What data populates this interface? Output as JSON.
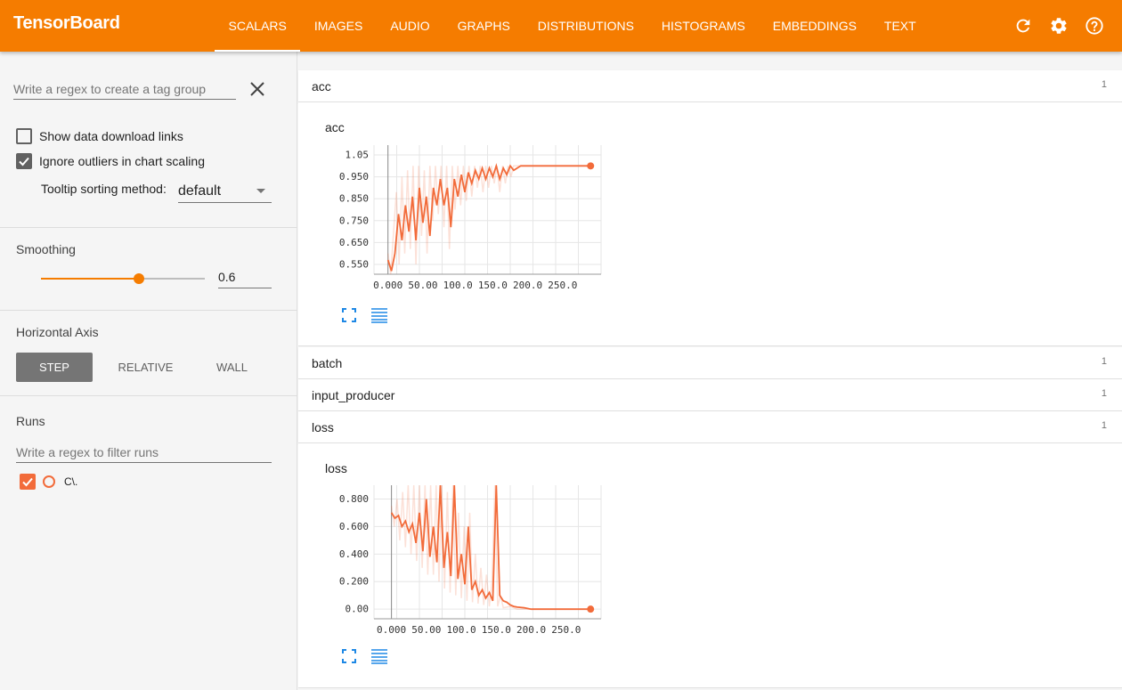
{
  "topbar": {
    "brand": "TensorBoard",
    "tabs": [
      "SCALARS",
      "IMAGES",
      "AUDIO",
      "GRAPHS",
      "DISTRIBUTIONS",
      "HISTOGRAMS",
      "EMBEDDINGS",
      "TEXT"
    ],
    "active_tab": "SCALARS",
    "icons": [
      "refresh-icon",
      "settings-icon",
      "help-icon"
    ]
  },
  "sidebar": {
    "tag_regex_placeholder": "Write a regex to create a tag group",
    "show_download_label": "Show data download links",
    "show_download_checked": false,
    "ignore_outliers_label": "Ignore outliers in chart scaling",
    "ignore_outliers_checked": true,
    "tooltip_sort_label": "Tooltip sorting method:",
    "tooltip_sort_value": "default",
    "smoothing_title": "Smoothing",
    "smoothing_value": "0.6",
    "horizontal_axis_title": "Horizontal Axis",
    "axis_options": [
      "STEP",
      "RELATIVE",
      "WALL"
    ],
    "axis_active": "STEP",
    "runs_title": "Runs",
    "runs_filter_placeholder": "Write a regex to filter runs",
    "runs": [
      {
        "name": "C\\.",
        "checked": true,
        "color": "#f26b3a"
      }
    ]
  },
  "groups": [
    {
      "name": "acc",
      "count": "1"
    },
    {
      "name": "batch",
      "count": "1"
    },
    {
      "name": "input_producer",
      "count": "1"
    },
    {
      "name": "loss",
      "count": "1"
    }
  ],
  "accent_color": "#f57c00",
  "series_color": "#f26b3a",
  "chart_data": [
    {
      "type": "line",
      "title": "acc",
      "x_ticks": [
        "0.000",
        "50.00",
        "100.0",
        "150.0",
        "200.0",
        "250.0"
      ],
      "y_ticks": [
        "0.550",
        "0.650",
        "0.750",
        "0.850",
        "0.950",
        "1.05"
      ],
      "xlim": [
        -20,
        305
      ],
      "ylim": [
        0.505,
        1.095
      ],
      "series": [
        {
          "smoothed": [
            [
              0,
              0.57
            ],
            [
              5,
              0.52
            ],
            [
              10,
              0.6
            ],
            [
              15,
              0.78
            ],
            [
              20,
              0.66
            ],
            [
              25,
              0.82
            ],
            [
              30,
              0.7
            ],
            [
              35,
              0.86
            ],
            [
              40,
              0.66
            ],
            [
              45,
              0.9
            ],
            [
              50,
              0.74
            ],
            [
              55,
              0.86
            ],
            [
              60,
              0.68
            ],
            [
              65,
              0.9
            ],
            [
              70,
              0.82
            ],
            [
              75,
              0.94
            ],
            [
              80,
              0.82
            ],
            [
              85,
              0.9
            ],
            [
              90,
              0.72
            ],
            [
              95,
              0.94
            ],
            [
              100,
              0.86
            ],
            [
              105,
              0.96
            ],
            [
              110,
              0.88
            ],
            [
              115,
              0.97
            ],
            [
              120,
              0.92
            ],
            [
              125,
              0.98
            ],
            [
              130,
              0.94
            ],
            [
              135,
              0.99
            ],
            [
              140,
              0.94
            ],
            [
              145,
              0.99
            ],
            [
              150,
              0.95
            ],
            [
              155,
              1.0
            ],
            [
              160,
              0.94
            ],
            [
              165,
              0.99
            ],
            [
              170,
              0.96
            ],
            [
              175,
              1.0
            ],
            [
              180,
              0.98
            ],
            [
              190,
              1.0
            ],
            [
              200,
              1.0
            ],
            [
              210,
              1.0
            ],
            [
              220,
              1.0
            ],
            [
              230,
              1.0
            ],
            [
              240,
              1.0
            ],
            [
              250,
              1.0
            ],
            [
              260,
              1.0
            ],
            [
              270,
              1.0
            ],
            [
              280,
              1.0
            ],
            [
              290,
              1.0
            ]
          ],
          "raw": [
            [
              0,
              0.6
            ],
            [
              4,
              0.5
            ],
            [
              8,
              0.7
            ],
            [
              12,
              0.88
            ],
            [
              16,
              0.55
            ],
            [
              20,
              0.95
            ],
            [
              24,
              0.6
            ],
            [
              28,
              0.98
            ],
            [
              32,
              0.62
            ],
            [
              36,
              1.0
            ],
            [
              40,
              0.55
            ],
            [
              44,
              1.0
            ],
            [
              48,
              0.68
            ],
            [
              52,
              0.98
            ],
            [
              56,
              0.6
            ],
            [
              60,
              1.0
            ],
            [
              64,
              0.75
            ],
            [
              68,
              1.0
            ],
            [
              72,
              0.78
            ],
            [
              76,
              1.0
            ],
            [
              80,
              0.72
            ],
            [
              84,
              1.0
            ],
            [
              88,
              0.62
            ],
            [
              92,
              1.0
            ],
            [
              96,
              0.8
            ],
            [
              100,
              1.0
            ],
            [
              104,
              0.82
            ],
            [
              108,
              1.0
            ],
            [
              112,
              0.84
            ],
            [
              116,
              1.0
            ],
            [
              120,
              0.86
            ],
            [
              124,
              1.0
            ],
            [
              128,
              0.9
            ],
            [
              132,
              1.0
            ],
            [
              136,
              0.88
            ],
            [
              140,
              1.0
            ],
            [
              144,
              0.9
            ],
            [
              148,
              1.0
            ],
            [
              152,
              0.92
            ],
            [
              156,
              1.0
            ],
            [
              160,
              0.88
            ],
            [
              164,
              1.0
            ],
            [
              168,
              0.92
            ],
            [
              172,
              1.0
            ],
            [
              176,
              0.95
            ],
            [
              180,
              1.0
            ],
            [
              190,
              1.0
            ],
            [
              200,
              1.0
            ],
            [
              290,
              1.0
            ]
          ]
        }
      ]
    },
    {
      "type": "line",
      "title": "loss",
      "x_ticks": [
        "0.000",
        "50.00",
        "100.0",
        "150.0",
        "200.0",
        "250.0"
      ],
      "y_ticks": [
        "0.00",
        "0.200",
        "0.400",
        "0.600",
        "0.800"
      ],
      "xlim": [
        -25,
        300
      ],
      "ylim": [
        -0.07,
        0.9
      ],
      "series": [
        {
          "smoothed": [
            [
              0,
              0.7
            ],
            [
              5,
              0.66
            ],
            [
              10,
              0.68
            ],
            [
              15,
              0.6
            ],
            [
              20,
              0.64
            ],
            [
              25,
              0.56
            ],
            [
              30,
              0.62
            ],
            [
              35,
              0.48
            ],
            [
              40,
              0.7
            ],
            [
              45,
              0.42
            ],
            [
              50,
              0.8
            ],
            [
              55,
              0.38
            ],
            [
              60,
              0.6
            ],
            [
              65,
              0.34
            ],
            [
              70,
              0.9
            ],
            [
              75,
              0.3
            ],
            [
              80,
              0.56
            ],
            [
              85,
              0.24
            ],
            [
              90,
              0.9
            ],
            [
              95,
              0.22
            ],
            [
              100,
              0.4
            ],
            [
              105,
              0.18
            ],
            [
              110,
              0.6
            ],
            [
              115,
              0.14
            ],
            [
              120,
              0.2
            ],
            [
              125,
              0.1
            ],
            [
              130,
              0.14
            ],
            [
              135,
              0.08
            ],
            [
              140,
              0.12
            ],
            [
              145,
              0.06
            ],
            [
              150,
              0.9
            ],
            [
              155,
              0.1
            ],
            [
              160,
              0.06
            ],
            [
              165,
              0.05
            ],
            [
              170,
              0.03
            ],
            [
              175,
              0.02
            ],
            [
              180,
              0.015
            ],
            [
              190,
              0.01
            ],
            [
              200,
              0.0
            ],
            [
              210,
              0.0
            ],
            [
              220,
              0.0
            ],
            [
              230,
              0.0
            ],
            [
              240,
              0.0
            ],
            [
              250,
              0.0
            ],
            [
              260,
              0.0
            ],
            [
              270,
              0.0
            ],
            [
              285,
              0.0
            ]
          ],
          "raw": [
            [
              0,
              0.75
            ],
            [
              4,
              0.6
            ],
            [
              8,
              0.8
            ],
            [
              12,
              0.5
            ],
            [
              16,
              0.85
            ],
            [
              20,
              0.45
            ],
            [
              24,
              0.9
            ],
            [
              28,
              0.4
            ],
            [
              32,
              0.9
            ],
            [
              36,
              0.35
            ],
            [
              40,
              0.9
            ],
            [
              44,
              0.3
            ],
            [
              48,
              0.9
            ],
            [
              52,
              0.25
            ],
            [
              56,
              0.9
            ],
            [
              60,
              0.25
            ],
            [
              64,
              0.9
            ],
            [
              68,
              0.2
            ],
            [
              72,
              0.9
            ],
            [
              76,
              0.15
            ],
            [
              80,
              0.85
            ],
            [
              84,
              0.12
            ],
            [
              88,
              0.9
            ],
            [
              92,
              0.1
            ],
            [
              96,
              0.7
            ],
            [
              100,
              0.08
            ],
            [
              104,
              0.6
            ],
            [
              108,
              0.06
            ],
            [
              112,
              0.7
            ],
            [
              116,
              0.05
            ],
            [
              120,
              0.4
            ],
            [
              124,
              0.04
            ],
            [
              128,
              0.3
            ],
            [
              132,
              0.03
            ],
            [
              136,
              0.25
            ],
            [
              140,
              0.02
            ],
            [
              144,
              0.2
            ],
            [
              148,
              0.9
            ],
            [
              152,
              0.02
            ],
            [
              156,
              0.1
            ],
            [
              160,
              0.01
            ],
            [
              170,
              0.02
            ],
            [
              180,
              0.0
            ],
            [
              285,
              0.0
            ]
          ]
        }
      ]
    }
  ]
}
